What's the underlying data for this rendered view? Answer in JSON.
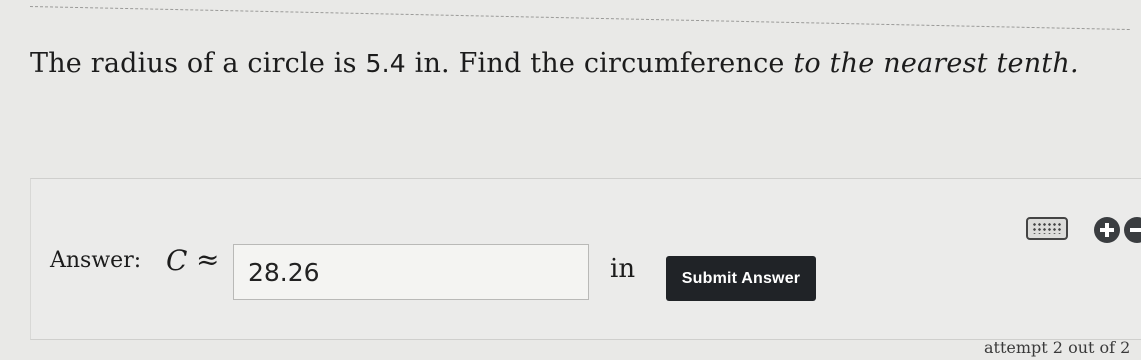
{
  "question": {
    "prefix": "The radius of a circle is ",
    "radius_value": "5.4",
    "middle": " in. Find the circumference ",
    "emphasis": "to the nearest tenth."
  },
  "answer": {
    "label": "Answer:",
    "variable": "C",
    "approx_symbol": "≈",
    "input_value": "28.26",
    "unit": "in"
  },
  "submit_label": "Submit Answer",
  "attempt_text": "attempt 2 out of 2",
  "icons": {
    "keypad": "keypad-icon",
    "plus": "plus-circle-icon",
    "minus": "minus-circle-icon"
  },
  "colors": {
    "background": "#e9e9e7",
    "submit_button": "#202327",
    "submit_text": "#ffffff"
  }
}
